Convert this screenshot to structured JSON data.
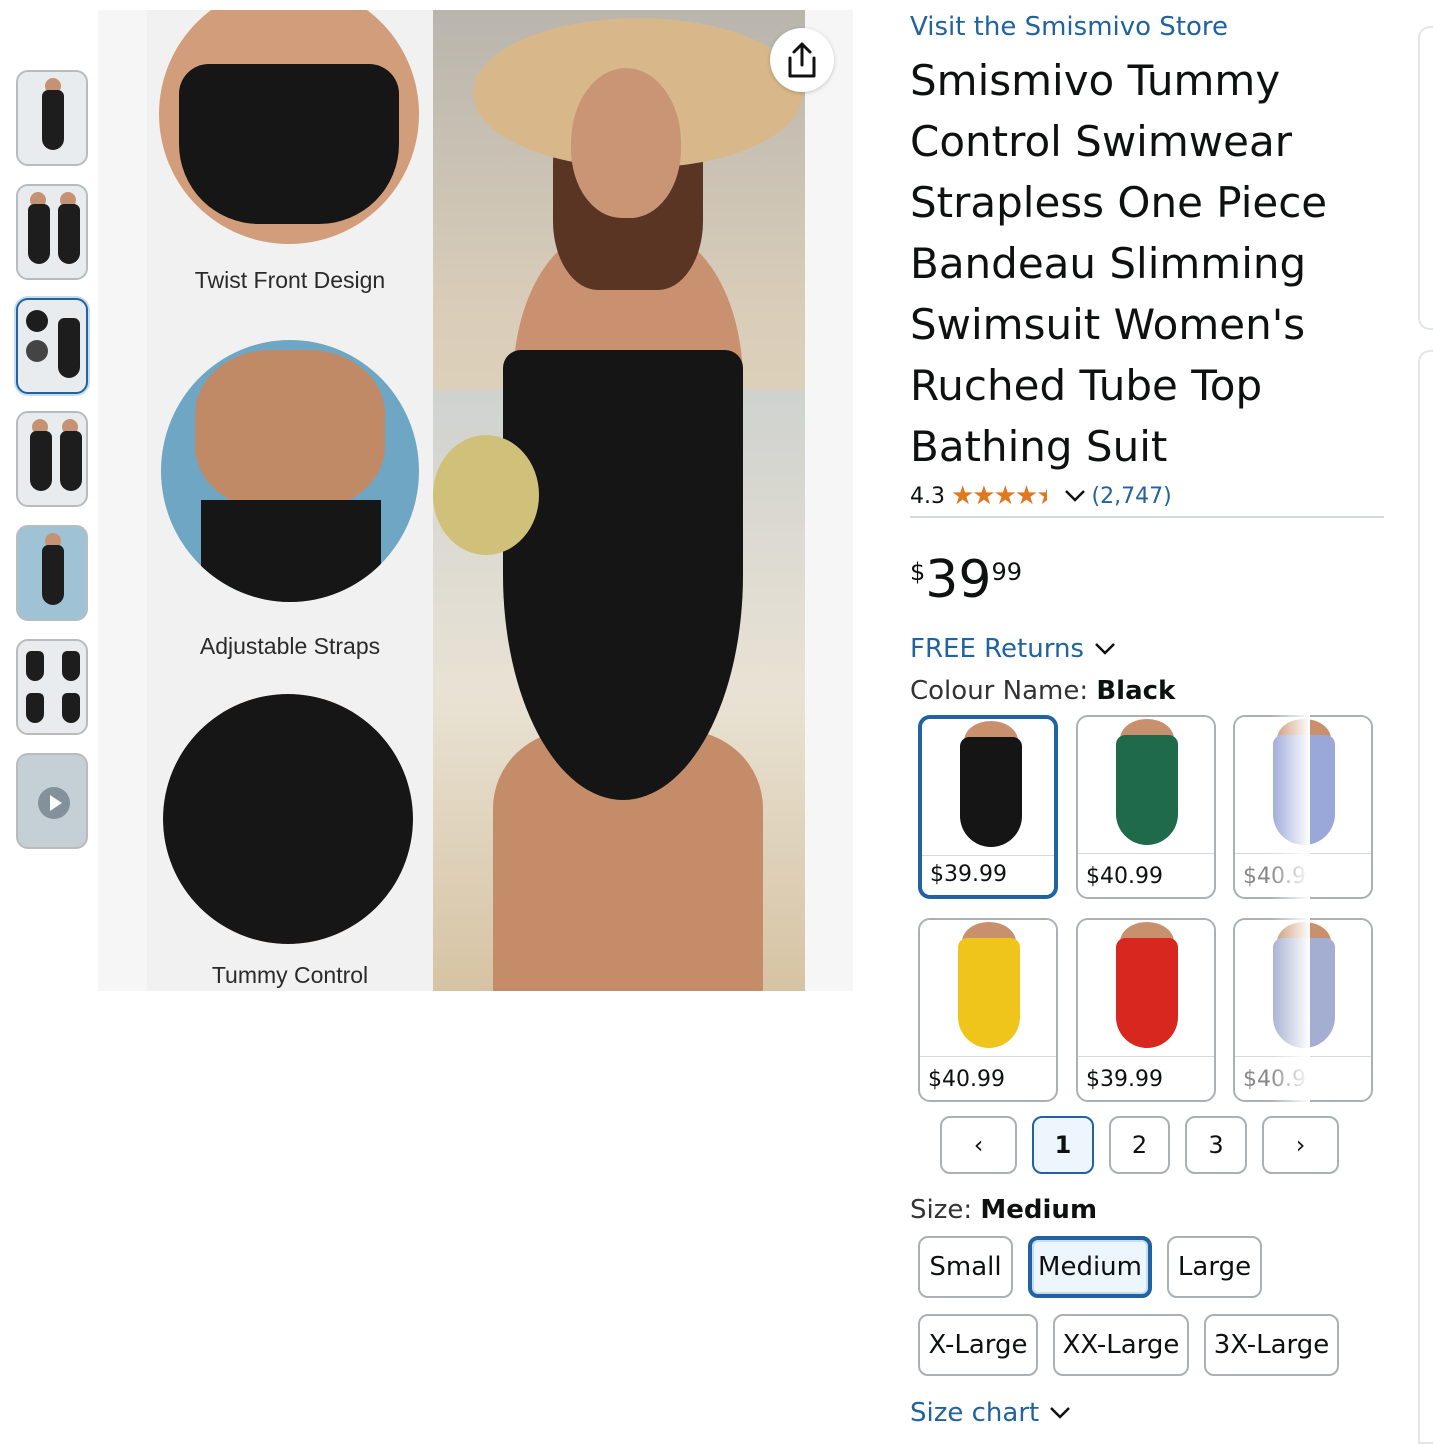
{
  "store_link": "Visit the Smismivo Store",
  "product_title": "Smismivo Tummy Control Swimwear Strapless One Piece Bandeau Slimming Swimsuit Women's Ruched Tube Top Bathing Suit",
  "rating": {
    "value": "4.3",
    "count": "(2,747)",
    "stars": 4.3
  },
  "price": {
    "currency": "$",
    "whole": "39",
    "fraction": "99"
  },
  "returns": "FREE Returns",
  "colour": {
    "label": "Colour Name: ",
    "value": "Black"
  },
  "swatches": [
    {
      "price": "$39.99",
      "color": "#151515"
    },
    {
      "price": "$40.99",
      "color": "#1f6a4b"
    },
    {
      "price": "$40.9",
      "color": "#9aa7d9"
    },
    {
      "price": "$40.99",
      "color": "#f0c51b"
    },
    {
      "price": "$39.99",
      "color": "#d8271f"
    },
    {
      "price": "$40.9",
      "color": "#a3aed1"
    }
  ],
  "pagination": {
    "prev": "‹",
    "pages": [
      "1",
      "2",
      "3"
    ],
    "next": "›",
    "current": "1"
  },
  "size": {
    "label": "Size: ",
    "value": "Medium",
    "options": [
      "Small",
      "Medium",
      "Large",
      "X-Large",
      "XX-Large",
      "3X-Large"
    ]
  },
  "size_chart": "Size chart",
  "image_captions": {
    "c1": "Twist Front Design",
    "c2": "Adjustable Straps",
    "c3": "Tummy Control"
  },
  "icons": {
    "share": "share-icon",
    "chevron": "chevron-down-icon",
    "play": "play-icon"
  }
}
